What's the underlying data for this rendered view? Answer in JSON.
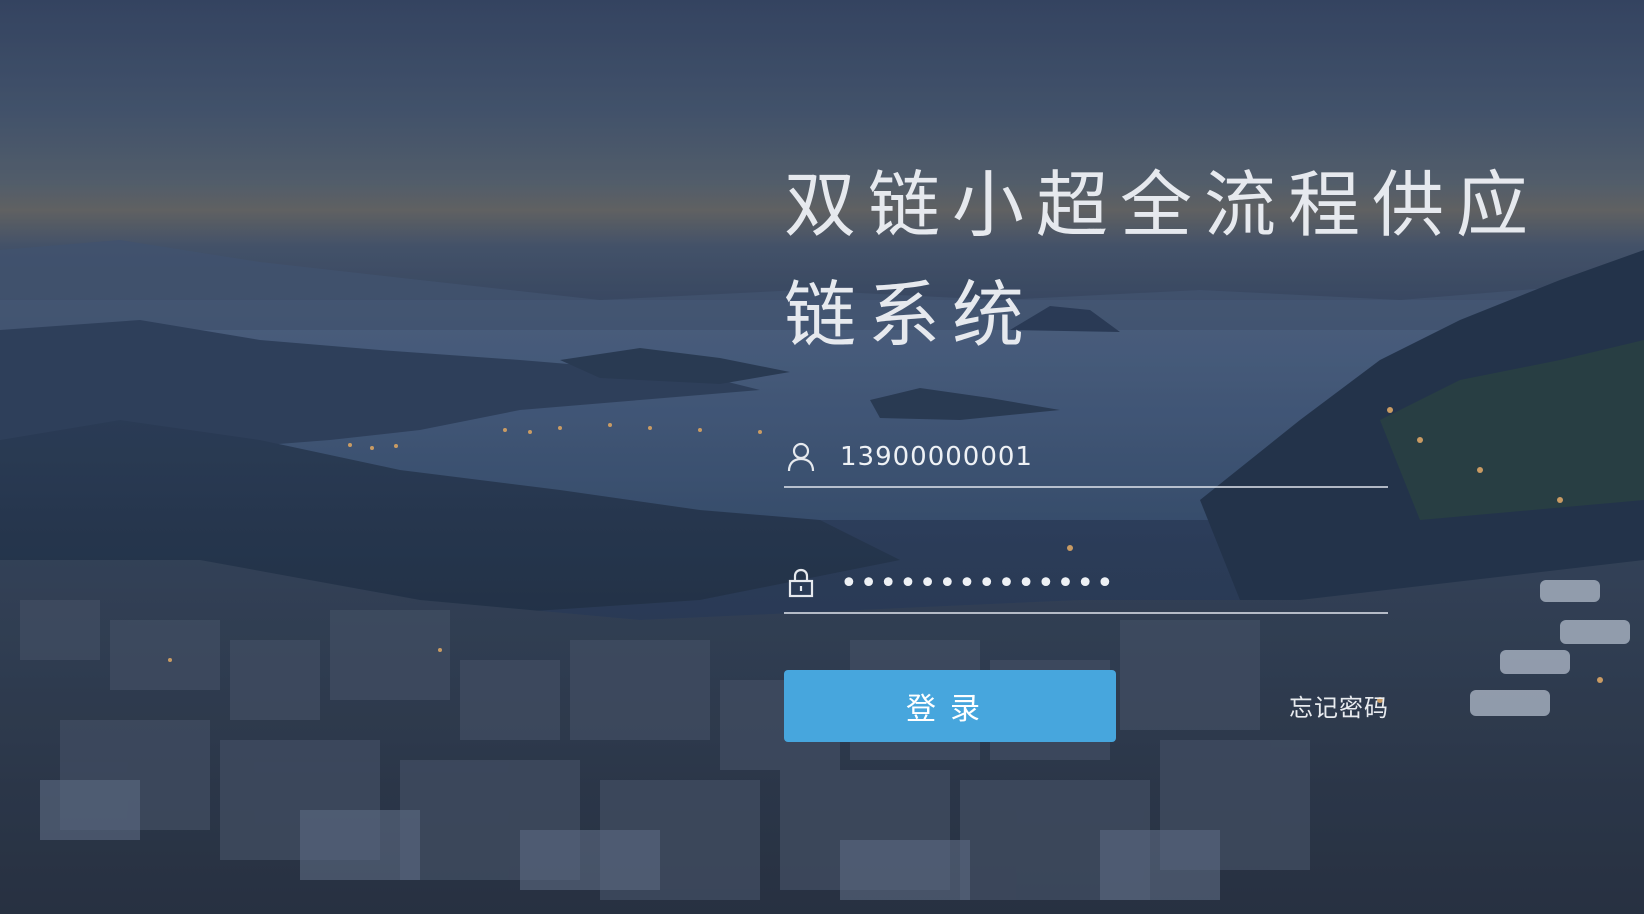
{
  "login": {
    "title": "双链小超全流程供应链系统",
    "username": {
      "value": "13900000001",
      "icon": "user-icon"
    },
    "password": {
      "value": "••••••••••••••",
      "icon": "lock-icon"
    },
    "submit_label": "登录",
    "forgot_label": "忘记密码"
  },
  "colors": {
    "button": "#47a6dd",
    "text": "#e6e9ee"
  }
}
